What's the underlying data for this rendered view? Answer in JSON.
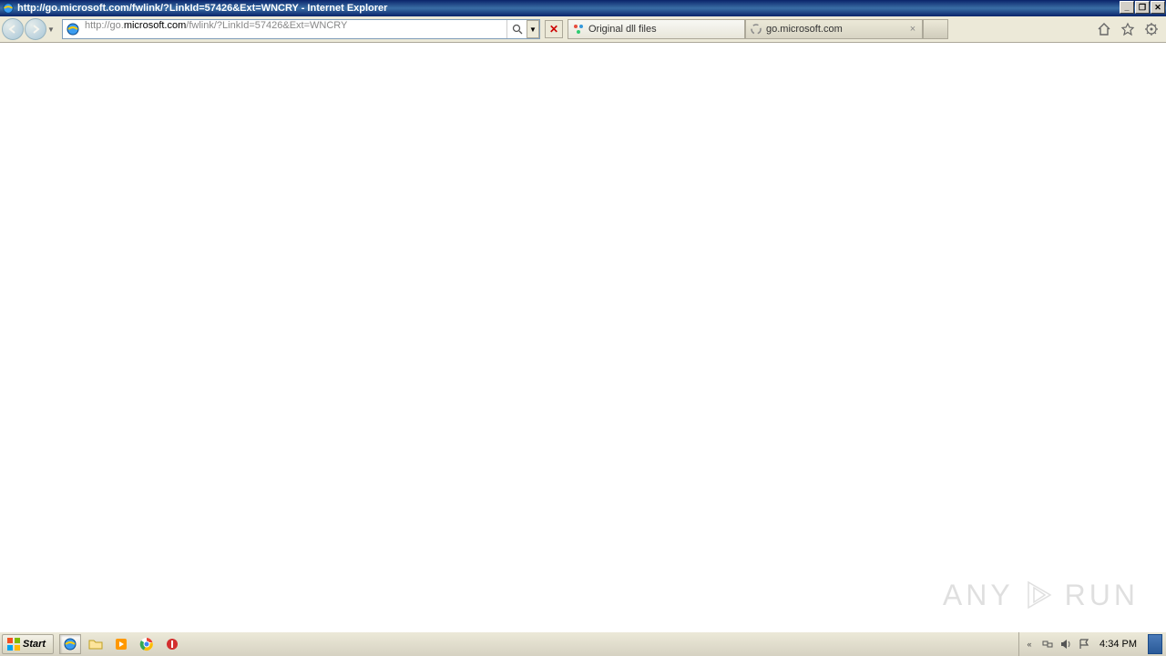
{
  "window": {
    "title": "http://go.microsoft.com/fwlink/?LinkId=57426&Ext=WNCRY - Internet Explorer"
  },
  "address": {
    "url_prefix": "http://go.",
    "url_domain": "microsoft.com",
    "url_suffix": "/fwlink/?LinkId=57426&Ext=WNCRY"
  },
  "tabs": [
    {
      "label": "Original dll files",
      "loading": false
    },
    {
      "label": "go.microsoft.com",
      "loading": true
    }
  ],
  "taskbar": {
    "start": "Start",
    "clock": "4:34 PM"
  },
  "watermark": {
    "left": "ANY",
    "right": "RUN"
  }
}
